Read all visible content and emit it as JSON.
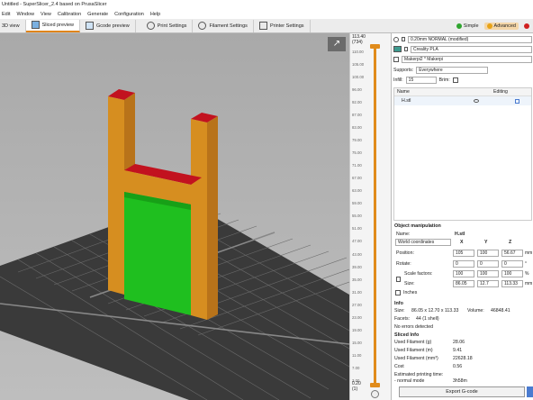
{
  "window": {
    "title": "Untitled - SuperSlicer_2.4  based on PrusaSlicer"
  },
  "menu": [
    "Edit",
    "Window",
    "View",
    "Calibration",
    "Generate",
    "Configuration",
    "Help"
  ],
  "tabs": [
    {
      "label": "3D view"
    },
    {
      "label": "Sliced preview"
    },
    {
      "label": "Gcode preview"
    },
    {
      "label": "Print Settings"
    },
    {
      "label": "Filament Settings"
    },
    {
      "label": "Printer Settings"
    }
  ],
  "modes": [
    {
      "label": "Simple",
      "color": "#2fa52f"
    },
    {
      "label": "Advanced",
      "color": "#e8a316"
    },
    {
      "label": "",
      "color": "#d02020"
    }
  ],
  "layer_slider": {
    "top_value": "113.40",
    "top_layer": "(734)",
    "bottom_value": "0.20",
    "bottom_layer": "(1)",
    "ticks": [
      "110.00",
      "105.00",
      "100.00",
      "96.00",
      "92.00",
      "87.00",
      "83.00",
      "79.00",
      "75.00",
      "71.00",
      "67.00",
      "63.00",
      "59.00",
      "55.00",
      "51.00",
      "47.00",
      "43.00",
      "39.00",
      "35.00",
      "31.00",
      "27.00",
      "23.00",
      "19.00",
      "15.00",
      "11.00",
      "7.00",
      "3.00"
    ]
  },
  "presets": {
    "print": "0.20mm NORMAL (modified)",
    "filament": "Creality PLA",
    "filament_color": "#3d9a8f",
    "printer": "Makerpi2 * Makerpi"
  },
  "supports": {
    "label": "Supports:",
    "value": "Everywhere"
  },
  "infill": {
    "label": "Infill:",
    "value": "15",
    "brim_label": "Brim:"
  },
  "object_list": {
    "col_name": "Name",
    "col_editing": "Editing",
    "items": [
      "H.stl"
    ]
  },
  "object_manipulation": {
    "title": "Object manipulation",
    "name_label": "Name:",
    "name_value": "H.stl",
    "coords": "World coordinates",
    "axes": [
      "X",
      "Y",
      "Z"
    ],
    "position_label": "Position:",
    "position": [
      "105",
      "100",
      "56.67"
    ],
    "position_unit": "mm",
    "rotate_label": "Rotate:",
    "rotate": [
      "0",
      "0",
      "0"
    ],
    "rotate_unit": "°",
    "scale_label": "Scale factors:",
    "scale": [
      "100",
      "100",
      "100"
    ],
    "scale_unit": "%",
    "size_label": "Size:",
    "size": [
      "86.05",
      "12.7",
      "113.33"
    ],
    "size_unit": "mm",
    "inches_label": "Inches"
  },
  "info": {
    "title": "Info",
    "size_label": "Size:",
    "size_value": "86.05 x 12.70 x 113.33",
    "volume_label": "Volume:",
    "volume_value": "46848.41",
    "facets_label": "Facets:",
    "facets_value": "44 (1 shell)",
    "errors": "No errors detected"
  },
  "sliced_info": {
    "title": "Sliced Info",
    "rows": [
      {
        "label": "Used Filament (g)",
        "value": "28.06"
      },
      {
        "label": "Used Filament (m)",
        "value": "9.41"
      },
      {
        "label": "Used Filament (mm³)",
        "value": "22628.18"
      },
      {
        "label": "Cost",
        "value": "0.56"
      },
      {
        "label": "Estimated printing time:",
        "value": ""
      },
      {
        "label": "- normal mode",
        "value": "3h58m"
      }
    ]
  },
  "export_button": "Export G-code"
}
